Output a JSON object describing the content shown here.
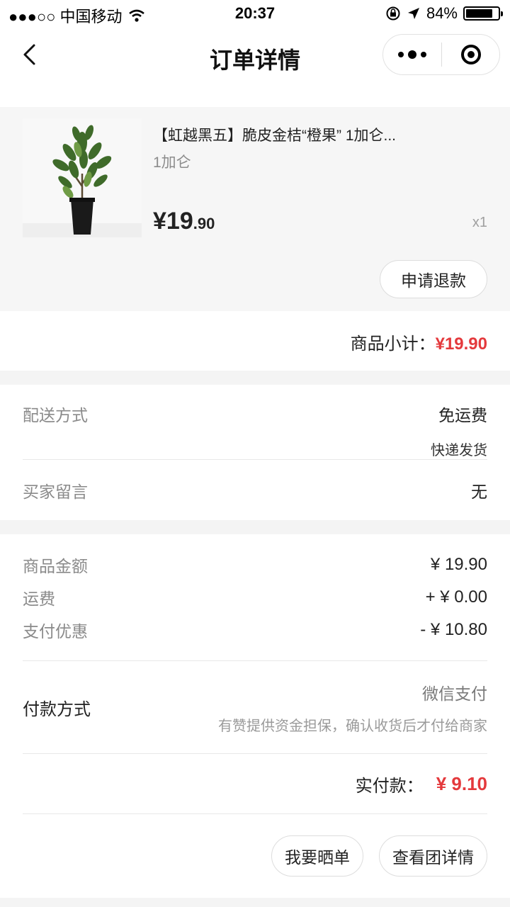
{
  "status_bar": {
    "carrier": "●●●○○ 中国移动",
    "time": "20:37",
    "battery_text": "84%",
    "battery_level": 0.84
  },
  "nav": {
    "title": "订单详情"
  },
  "product": {
    "name": "【虹越黑五】脆皮金桔“橙果” 1加仑...",
    "spec": "1加仑",
    "price_int": "¥19",
    "price_dec": ".90",
    "quantity": "x1",
    "refund_label": "申请退款"
  },
  "subtotal": {
    "label": "商品小计：",
    "value": "¥19.90"
  },
  "delivery": {
    "label": "配送方式",
    "value": "免运费",
    "sub_value": "快递发货"
  },
  "remark": {
    "label": "买家留言",
    "value": "无"
  },
  "amounts": [
    {
      "label": "商品金额",
      "value": "¥ 19.90"
    },
    {
      "label": "运费",
      "value": "+ ¥ 0.00"
    },
    {
      "label": "支付优惠",
      "value": "- ¥ 10.80"
    }
  ],
  "payment": {
    "label": "付款方式",
    "method": "微信支付",
    "note": "有赞提供资金担保，确认收货后才付给商家"
  },
  "paid": {
    "label": "实付款：",
    "value": "¥ 9.10"
  },
  "actions": {
    "share_label": "我要晒单",
    "group_label": "查看团详情"
  },
  "colors": {
    "accent_red": "#e4393c"
  }
}
